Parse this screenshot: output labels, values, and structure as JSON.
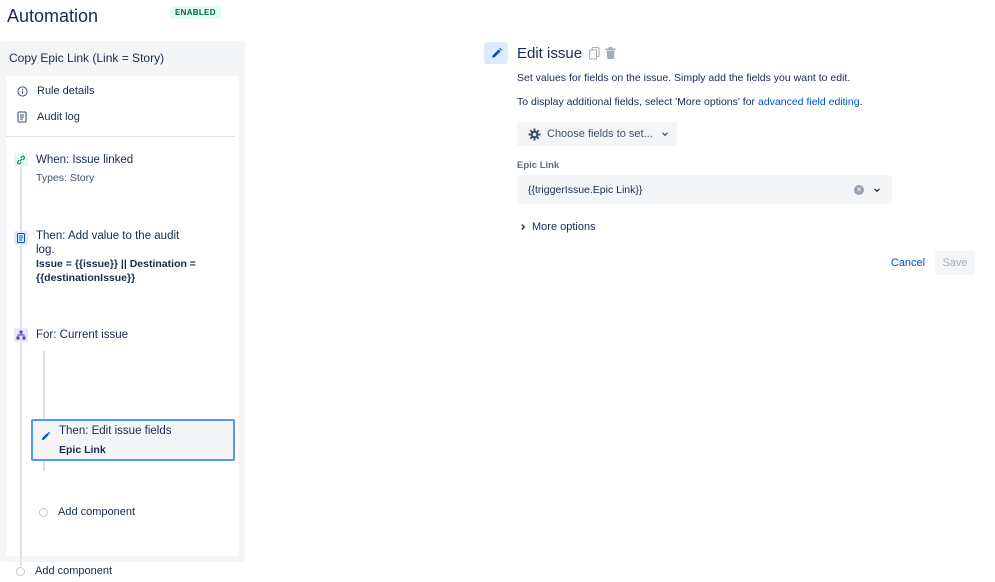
{
  "header": {
    "title": "Automation",
    "status_badge": "ENABLED"
  },
  "rule": {
    "name": "Copy Epic Link (Link = Story)"
  },
  "nav": {
    "rule_details": "Rule details",
    "audit_log": "Audit log"
  },
  "steps": {
    "trigger": {
      "title": "When: Issue linked",
      "subtitle": "Types: Story"
    },
    "audit": {
      "title_line1": "Then: Add value to the audit",
      "title_line2": "log.",
      "detail_line1": "Issue = {{issue}} || Destination =",
      "detail_line2": "{{destinationIssue}}"
    },
    "branch": {
      "title": "For: Current issue"
    },
    "edit": {
      "title": "Then: Edit issue fields",
      "subtitle": "Epic Link"
    },
    "add_inner": "Add component",
    "add_outer": "Add component"
  },
  "editor": {
    "title": "Edit issue",
    "description": "Set values for fields on the issue. Simply add the fields you want to edit.",
    "additional_prefix": "To display additional fields, select 'More options' for",
    "additional_link": "advanced field editing",
    "additional_suffix": ".",
    "choose_fields": "Choose fields to set...",
    "field_label": "Epic Link",
    "field_value": "{{triggerIssue.Epic Link}}",
    "more_options": "More options",
    "cancel": "Cancel",
    "save": "Save"
  },
  "colors": {
    "primary": "#0052cc",
    "text": "#172b4d",
    "panel_bg": "#f4f5f7",
    "selected_border": "#4c9aff",
    "enabled_bg": "#e3fcef",
    "enabled_text": "#006644"
  }
}
